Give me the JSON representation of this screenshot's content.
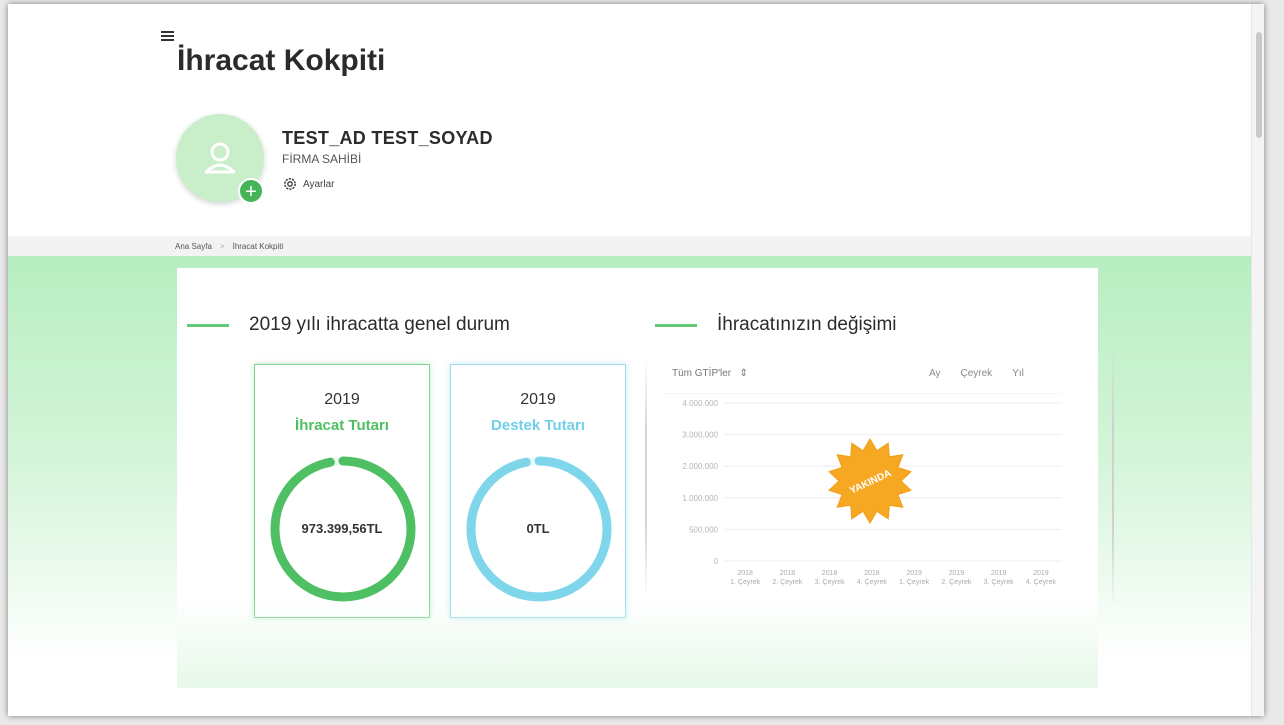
{
  "header": {
    "title": "İhracat Kokpiti"
  },
  "user": {
    "name": "TEST_AD TEST_SOYAD",
    "role": "FİRMA SAHİBİ",
    "settings_label": "Ayarlar"
  },
  "breadcrumb": [
    "Ana Sayfa",
    "İhracat Kokpiti"
  ],
  "overview": {
    "heading": "2019 yılı ihracatta genel durum",
    "export_card": {
      "year": "2019",
      "label": "İhracat Tutarı",
      "value": "973.399,56TL",
      "fill_fraction": 0.97,
      "color": "#4fbf63"
    },
    "support_card": {
      "year": "2019",
      "label": "Destek Tutarı",
      "value": "0TL",
      "fill_fraction": 0.97,
      "color": "#7fd6ea"
    }
  },
  "change": {
    "heading": "İhracatınızın değişimi",
    "filter_label": "Tüm GTİP'ler",
    "period_tabs": [
      "Ay",
      "Çeyrek",
      "Yıl"
    ],
    "badge_text": "YAKINDA",
    "badge_color": "#f7a823"
  },
  "chart_data": {
    "type": "line",
    "y_ticks": [
      "0",
      "500.000",
      "1.000.000",
      "2.000.000",
      "3.000.000",
      "4.000.000"
    ],
    "categories": [
      [
        "2018",
        "1. Çeyrek"
      ],
      [
        "2018",
        "2. Çeyrek"
      ],
      [
        "2018",
        "3. Çeyrek"
      ],
      [
        "2018",
        "4. Çeyrek"
      ],
      [
        "2019",
        "1. Çeyrek"
      ],
      [
        "2019",
        "2. Çeyrek"
      ],
      [
        "2019",
        "3. Çeyrek"
      ],
      [
        "2019",
        "4. Çeyrek"
      ]
    ],
    "series": [],
    "grid": true
  },
  "colors": {
    "accent_green": "#62c977",
    "ring_dark_green": "#3f9e4d",
    "ring_cyan": "#7fd6ea",
    "background_green": "#b7eec0"
  }
}
